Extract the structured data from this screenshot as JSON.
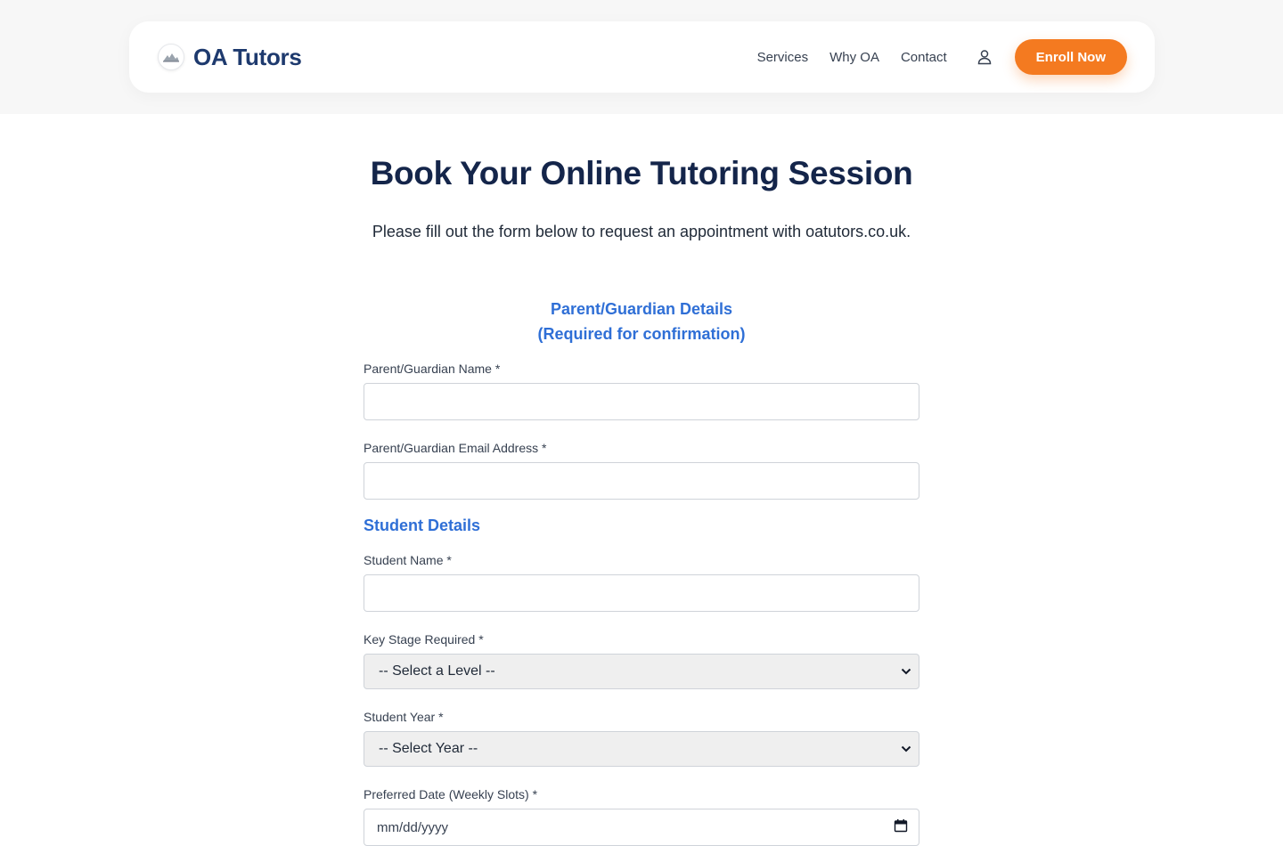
{
  "header": {
    "brand_name": "OA Tutors",
    "nav": [
      "Services",
      "Why OA",
      "Contact"
    ],
    "enroll_label": "Enroll Now"
  },
  "page": {
    "title": "Book Your Online Tutoring Session",
    "subtitle": "Please fill out the form below to request an appointment with oatutors.co.uk."
  },
  "form": {
    "parent_section": {
      "title_line1": "Parent/Guardian Details",
      "title_line2": "(Required for confirmation)"
    },
    "parent_name_label": "Parent/Guardian Name *",
    "parent_name_value": "",
    "parent_email_label": "Parent/Guardian Email Address *",
    "parent_email_value": "",
    "student_section_title": "Student Details",
    "student_name_label": "Student Name *",
    "student_name_value": "",
    "key_stage_label": "Key Stage Required *",
    "key_stage_selected": "-- Select a Level --",
    "student_year_label": "Student Year *",
    "student_year_selected": "-- Select Year --",
    "preferred_date_label": "Preferred Date (Weekly Slots) *",
    "preferred_date_placeholder": "mm/dd/yyyy"
  },
  "icons": {
    "brand": "mountain-logo-icon",
    "user": "user-icon",
    "select_arrow": "chevron-down-icon",
    "calendar": "calendar-icon"
  },
  "colors": {
    "brand_navy": "#1e3a6e",
    "accent_orange": "#f47a20",
    "section_blue": "#2f6fd6",
    "title_navy": "#14254a"
  }
}
